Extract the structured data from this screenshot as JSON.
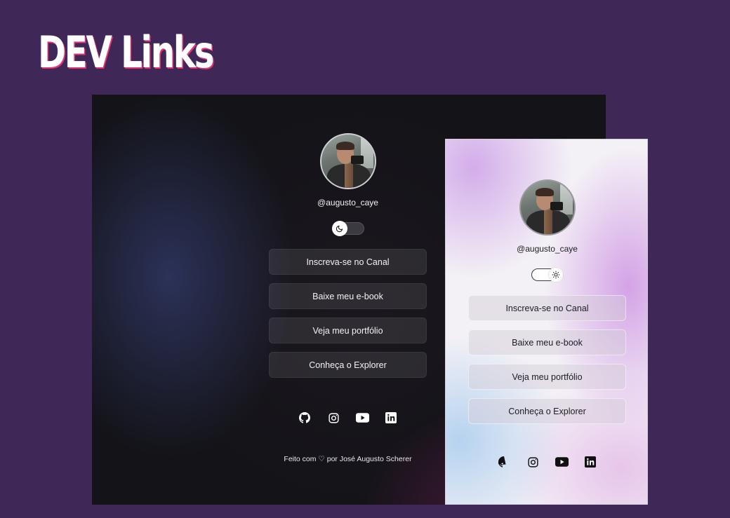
{
  "page": {
    "title": "DEV Links"
  },
  "dark": {
    "username": "@augusto_caye",
    "links": [
      "Inscreva-se no Canal",
      "Baixe meu e-book",
      "Veja meu portfólio",
      "Conheça o Explorer"
    ],
    "footer": "Feito com ♡ por José Augusto Scherer",
    "toggle_icon": "moon-icon",
    "socials": [
      "github-icon",
      "instagram-icon",
      "youtube-icon",
      "linkedin-icon"
    ]
  },
  "light": {
    "username": "@augusto_caye",
    "links": [
      "Inscreva-se no Canal",
      "Baixe meu e-book",
      "Veja meu portfólio",
      "Conheça o Explorer"
    ],
    "toggle_icon": "sun-icon",
    "socials": [
      "github-icon",
      "instagram-icon",
      "youtube-icon",
      "linkedin-icon"
    ]
  },
  "colors": {
    "page_bg": "#3f2857",
    "dark_bg": "#131318",
    "light_bg": "#f4f1f6"
  }
}
